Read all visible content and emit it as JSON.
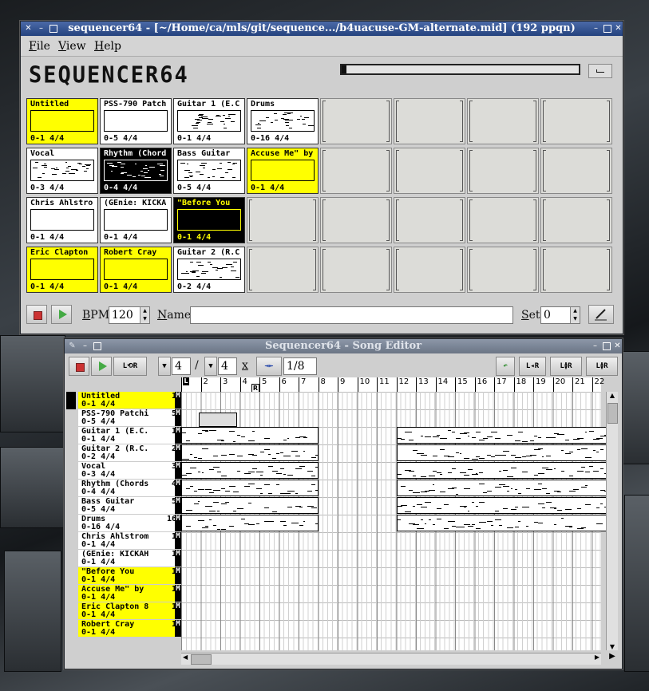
{
  "main_window": {
    "title": "sequencer64 - [~/Home/ca/mls/git/sequence.../b4uacuse-GM-alternate.mid] (192 ppqn)",
    "menu": [
      "File",
      "View",
      "Help"
    ],
    "logo": "SEQUENCER64",
    "progress": 0.02,
    "slots": [
      {
        "name": "Untitled",
        "info": "0-1 4/4",
        "style": "yellow"
      },
      {
        "name": "Vocal",
        "info": "0-3 4/4",
        "style": "white"
      },
      {
        "name": "Chris Ahlstro",
        "info": "0-1 4/4",
        "style": "white"
      },
      {
        "name": "Eric Clapton",
        "info": "0-1 4/4",
        "style": "yellow"
      },
      {
        "name": "PSS-790 Patch",
        "info": "0-5 4/4",
        "style": "white"
      },
      {
        "name": "Rhythm (Chord",
        "info": "0-4 4/4",
        "style": "black"
      },
      {
        "name": "(GEnie: KICKA",
        "info": "0-1 4/4",
        "style": "white"
      },
      {
        "name": "Robert Cray",
        "info": "0-1 4/4",
        "style": "yellow"
      },
      {
        "name": "Guitar 1 (E.C",
        "info": "0-1 4/4",
        "style": "white"
      },
      {
        "name": "Bass Guitar",
        "info": "0-5 4/4",
        "style": "white"
      },
      {
        "name": "\"Before You",
        "info": "0-1 4/4",
        "style": "black-yellow"
      },
      {
        "name": "Guitar 2 (R.C",
        "info": "0-2 4/4",
        "style": "white"
      },
      {
        "name": "Drums",
        "info": "0-16 4/4",
        "style": "white"
      },
      {
        "name": "Accuse Me\" by",
        "info": "0-1 4/4",
        "style": "yellow"
      }
    ],
    "bpm_label": "BPM",
    "bpm": "120",
    "name_label": "Name",
    "name_value": "",
    "set_label": "Set",
    "set_value": "0"
  },
  "song_editor": {
    "title": "Sequencer64 - Song Editor",
    "beats": "4",
    "beat_width": "4",
    "x_label": "x",
    "slash": "/",
    "snap": "1/8",
    "button_labels": {
      "loop": "L⟲R",
      "collapse": "L◂R",
      "expand": "L≬R",
      "copy": "L≬R"
    },
    "measures": [
      "1",
      "2",
      "3",
      "4",
      "5",
      "6",
      "7",
      "8",
      "9",
      "10",
      "11",
      "12",
      "13",
      "14",
      "15",
      "16",
      "17",
      "18",
      "19",
      "20",
      "21",
      "22"
    ],
    "marker_L": "L",
    "marker_R": "R",
    "set_number": "0",
    "mute_label": "M",
    "tracks": [
      {
        "line1": "Untitled",
        "line2": "0-1 4/4",
        "count": "1",
        "style": "yellow"
      },
      {
        "line1": "PSS-790 Patchi",
        "line2": "0-5 4/4",
        "count": "5",
        "style": "white"
      },
      {
        "line1": "Guitar 1 (E.C.",
        "line2": "0-1 4/4",
        "count": "1",
        "style": "white"
      },
      {
        "line1": "Guitar 2 (R.C.",
        "line2": "0-2 4/4",
        "count": "2",
        "style": "white"
      },
      {
        "line1": "Vocal",
        "line2": "0-3 4/4",
        "count": "3",
        "style": "white"
      },
      {
        "line1": "Rhythm (Chords",
        "line2": "0-4 4/4",
        "count": "4",
        "style": "white"
      },
      {
        "line1": "Bass Guitar",
        "line2": "0-5 4/4",
        "count": "5",
        "style": "white"
      },
      {
        "line1": "Drums",
        "line2": "0-16 4/4",
        "count": "16",
        "style": "white"
      },
      {
        "line1": "Chris Ahlstrom",
        "line2": "0-1 4/4",
        "count": "1",
        "style": "white"
      },
      {
        "line1": "(GEnie: KICKAH",
        "line2": "0-1 4/4",
        "count": "1",
        "style": "white"
      },
      {
        "line1": "\"Before You",
        "line2": "0-1 4/4",
        "count": "1",
        "style": "yellow"
      },
      {
        "line1": "Accuse Me\" by",
        "line2": "0-1 4/4",
        "count": "1",
        "style": "yellow"
      },
      {
        "line1": "Eric Clapton 8",
        "line2": "0-1 4/4",
        "count": "1",
        "style": "yellow"
      },
      {
        "line1": "Robert Cray",
        "line2": "0-1 4/4",
        "count": "1",
        "style": "yellow"
      }
    ]
  }
}
